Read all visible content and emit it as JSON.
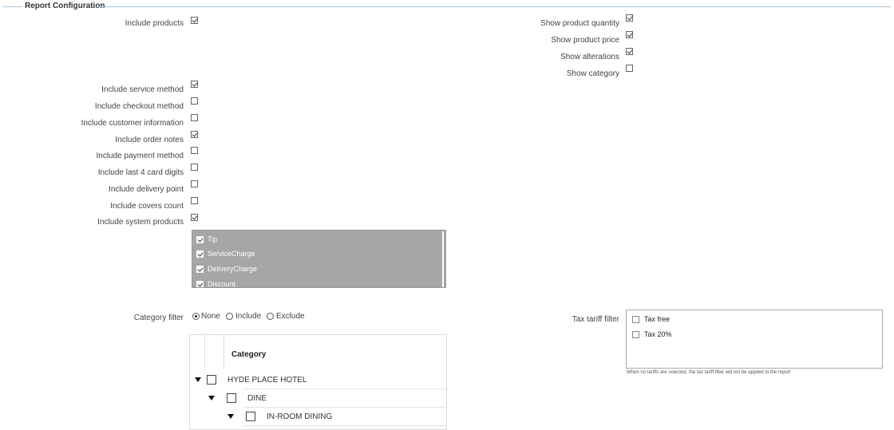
{
  "section": {
    "title": "Report Configuration"
  },
  "left_options": [
    {
      "label": "Include products",
      "checked": true
    },
    {
      "label": "Include service method",
      "checked": true
    },
    {
      "label": "Include checkout method",
      "checked": false
    },
    {
      "label": "Include customer information",
      "checked": false
    },
    {
      "label": "Include order notes",
      "checked": true
    },
    {
      "label": "Include payment method",
      "checked": false
    },
    {
      "label": "Include last 4 card digits",
      "checked": false
    },
    {
      "label": "Include delivery point",
      "checked": false
    },
    {
      "label": "Include covers count",
      "checked": false
    },
    {
      "label": "Include system products",
      "checked": true
    }
  ],
  "right_options": [
    {
      "label": "Show product quantity",
      "checked": true
    },
    {
      "label": "Show product price",
      "checked": true
    },
    {
      "label": "Show alterations",
      "checked": true
    },
    {
      "label": "Show category",
      "checked": false
    }
  ],
  "system_products": [
    {
      "label": "Tip",
      "checked": true
    },
    {
      "label": "ServiceCharge",
      "checked": true
    },
    {
      "label": "DeliveryCharge",
      "checked": true
    },
    {
      "label": "Discount",
      "checked": true
    }
  ],
  "category_filter": {
    "label": "Category filter",
    "options": [
      "None",
      "Include",
      "Exclude"
    ],
    "selected": "None"
  },
  "tree": {
    "header": "Category",
    "rows": [
      {
        "label": "HYDE PLACE HOTEL",
        "level": 0,
        "expanded": true,
        "checked": false
      },
      {
        "label": "DINE",
        "level": 1,
        "expanded": true,
        "checked": false
      },
      {
        "label": "IN-ROOM DINING",
        "level": 2,
        "expanded": true,
        "checked": false
      }
    ]
  },
  "tax_filter": {
    "label": "Tax tariff filter",
    "items": [
      {
        "label": "Tax free",
        "checked": false
      },
      {
        "label": "Tax 20%",
        "checked": false
      }
    ],
    "note": "When no tariffs are selected, the tax tariff filter will not be applied to the report"
  },
  "icons": {
    "tree_toggle": "triangle-down-icon"
  }
}
